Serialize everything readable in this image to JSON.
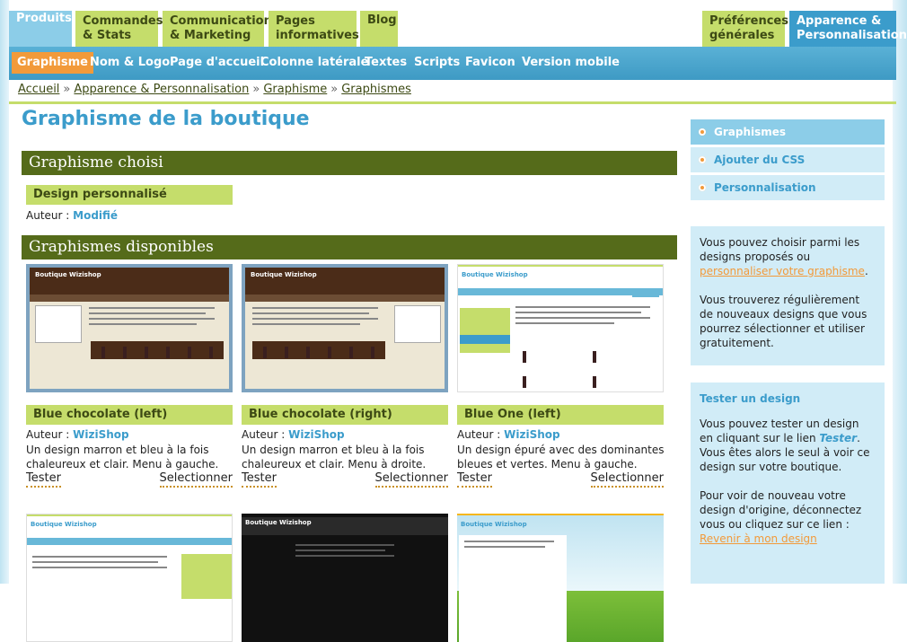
{
  "top_tabs": [
    {
      "l1": "Produits",
      "l2": ""
    },
    {
      "l1": "Commandes",
      "l2": "& Stats"
    },
    {
      "l1": "Communication",
      "l2": "& Marketing"
    },
    {
      "l1": "Pages",
      "l2": "informatives"
    },
    {
      "l1": "Blog",
      "l2": ""
    },
    {
      "l1": "Préférences",
      "l2": "générales"
    },
    {
      "l1": "Apparence &",
      "l2": "Personnalisation"
    }
  ],
  "sub_tabs": [
    "Graphisme",
    "Nom & Logo",
    "Page d'accueil",
    "Colonne latérale",
    "Textes",
    "Scripts",
    "Favicon",
    "Version mobile"
  ],
  "breadcrumb": [
    "Accueil",
    "Apparence & Personnalisation",
    "Graphisme",
    "Graphismes"
  ],
  "breadcrumb_sep": "»",
  "page_title": "Graphisme de la boutique",
  "chosen": {
    "section_title": "Graphisme choisi",
    "name": "Design personnalisé",
    "author_label": "Auteur :",
    "author": "Modifié"
  },
  "available": {
    "section_title": "Graphismes disponibles",
    "author_label": "Auteur :",
    "test_label": "Tester",
    "select_label": "Selectionner",
    "themes": [
      {
        "name": "Blue chocolate (left)",
        "author": "WiziShop",
        "desc1": "Un design marron et bleu à la fois",
        "desc2": "chaleureux et clair. Menu à gauche."
      },
      {
        "name": "Blue chocolate (right)",
        "author": "WiziShop",
        "desc1": "Un design marron et bleu à la fois",
        "desc2": "chaleureux et clair. Menu à droite."
      },
      {
        "name": "Blue One (left)",
        "author": "WiziShop",
        "desc1": "Un design épuré avec des dominantes",
        "desc2": "bleues et vertes. Menu à gauche."
      }
    ],
    "thumb_shop_title": "Boutique Wizishop"
  },
  "right_menu": [
    "Graphismes",
    "Ajouter du CSS",
    "Personnalisation"
  ],
  "info_box": {
    "p1_before": "Vous pouvez choisir parmi les designs proposés ou",
    "p1_link": "personnaliser votre graphisme",
    "p1_after": ".",
    "p2": "Vous trouverez régulièrement de nouveaux designs que vous pourrez sélectionner et utiliser gratuitement."
  },
  "test_box": {
    "title": "Tester un design",
    "p1_before": "Vous pouvez tester un design en cliquant sur le lien",
    "p1_em": "Tester",
    "p1_after": ". Vous êtes alors le seul à voir ce design sur votre boutique.",
    "p2": "Pour voir de nouveau votre design d'origine, déconnectez vous ou cliquez sur ce lien :",
    "p2_link": "Revenir à mon design"
  }
}
